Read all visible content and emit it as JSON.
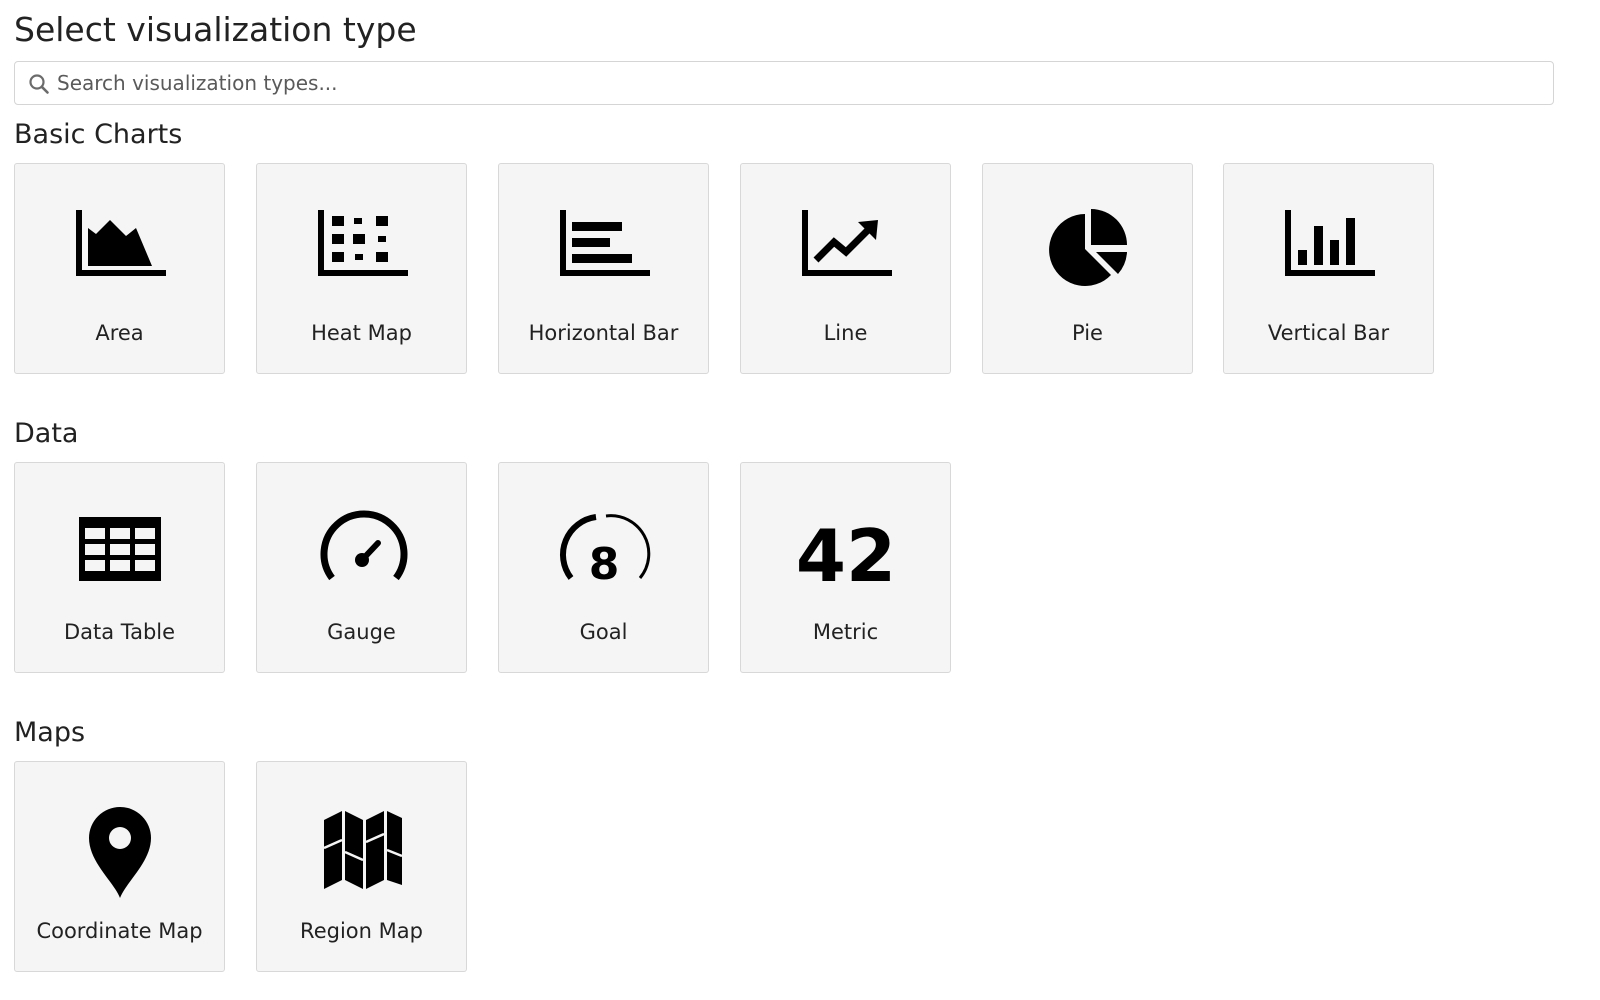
{
  "page": {
    "title": "Select visualization type"
  },
  "search": {
    "placeholder": "Search visualization types...",
    "value": "",
    "icon": "search-icon"
  },
  "sections": {
    "basic": {
      "title": "Basic Charts",
      "cards": [
        {
          "label": "Area",
          "icon": "area-chart-icon"
        },
        {
          "label": "Heat Map",
          "icon": "heat-map-icon"
        },
        {
          "label": "Horizontal Bar",
          "icon": "horizontal-bar-icon"
        },
        {
          "label": "Line",
          "icon": "line-chart-icon"
        },
        {
          "label": "Pie",
          "icon": "pie-chart-icon"
        },
        {
          "label": "Vertical Bar",
          "icon": "vertical-bar-icon"
        }
      ]
    },
    "data": {
      "title": "Data",
      "cards": [
        {
          "label": "Data Table",
          "icon": "data-table-icon"
        },
        {
          "label": "Gauge",
          "icon": "gauge-icon"
        },
        {
          "label": "Goal",
          "icon": "goal-icon",
          "icon_text": "8"
        },
        {
          "label": "Metric",
          "icon": "metric-icon",
          "icon_text": "42"
        }
      ]
    },
    "maps": {
      "title": "Maps",
      "cards": [
        {
          "label": "Coordinate Map",
          "icon": "map-pin-icon"
        },
        {
          "label": "Region Map",
          "icon": "folded-map-icon"
        }
      ]
    }
  },
  "colors": {
    "card_background": "#f5f5f5",
    "card_border": "#d8d8d8",
    "icon": "#000000",
    "text": "#222222"
  }
}
